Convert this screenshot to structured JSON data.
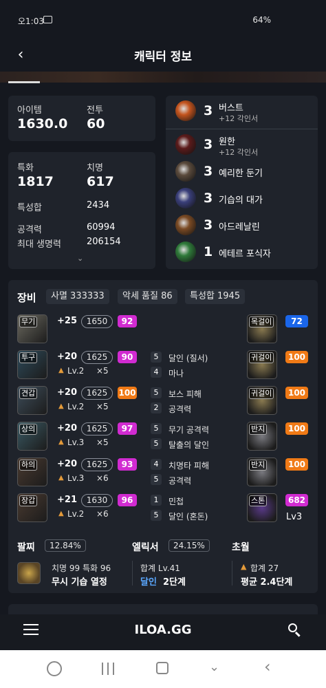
{
  "status": {
    "time": "오1:03",
    "battery": "64%"
  },
  "header": {
    "title": "캐릭터 정보"
  },
  "stats": {
    "item_label": "아이템",
    "item_value": "1630.0",
    "combat_label": "전투",
    "combat_value": "60",
    "spec_label": "특화",
    "spec_value": "1817",
    "crit_label": "치명",
    "crit_value": "617",
    "total_label": "특성합",
    "total_value": "2434",
    "atk_label": "공격력",
    "atk_value": "60994",
    "hp_label": "최대 생명력",
    "hp_value": "206154"
  },
  "engravings": [
    {
      "level": "3",
      "name": "버스트",
      "sub": "+12 각인서",
      "color": "#c4541e",
      "icon": "burst-icon"
    },
    {
      "level": "3",
      "name": "원한",
      "sub": "+12 각인서",
      "color": "#5b1b1b",
      "icon": "grudge-icon"
    },
    {
      "level": "3",
      "name": "예리한 둔기",
      "sub": "",
      "color": "#5a4a3c",
      "icon": "keen-blunt-icon"
    },
    {
      "level": "3",
      "name": "기습의 대가",
      "sub": "",
      "color": "#3a3f7a",
      "icon": "ambush-icon"
    },
    {
      "level": "3",
      "name": "아드레날린",
      "sub": "",
      "color": "#7a4a24",
      "icon": "adrenaline-icon"
    },
    {
      "level": "1",
      "name": "에테르 포식자",
      "sub": "",
      "color": "#2f7a3a",
      "icon": "ether-icon"
    }
  ],
  "equipment": {
    "title": "장비",
    "chips": [
      "사멸 333333",
      "악세 품질 86",
      "특성합 1945"
    ],
    "gear": [
      {
        "tag": "무기",
        "refine": "+25",
        "ilvl": "1650",
        "quality": "92",
        "qcolor": "#d12bd1",
        "elixir": "",
        "count": ""
      },
      {
        "tag": "투구",
        "refine": "+20",
        "ilvl": "1625",
        "quality": "90",
        "qcolor": "#d12bd1",
        "elixir": "Lv.2",
        "count": "×5"
      },
      {
        "tag": "견갑",
        "refine": "+20",
        "ilvl": "1625",
        "quality": "100",
        "qcolor": "#f07a16",
        "elixir": "Lv.2",
        "count": "×5"
      },
      {
        "tag": "상의",
        "refine": "+20",
        "ilvl": "1625",
        "quality": "97",
        "qcolor": "#d12bd1",
        "elixir": "Lv.3",
        "count": "×5"
      },
      {
        "tag": "하의",
        "refine": "+20",
        "ilvl": "1625",
        "quality": "93",
        "qcolor": "#d12bd1",
        "elixir": "Lv.3",
        "count": "×6"
      },
      {
        "tag": "장갑",
        "refine": "+21",
        "ilvl": "1630",
        "quality": "96",
        "qcolor": "#d12bd1",
        "elixir": "Lv.2",
        "count": "×6"
      }
    ],
    "effects": [
      [
        {
          "n": "5",
          "t": "달인 (질서)"
        },
        {
          "n": "4",
          "t": "마나"
        }
      ],
      [
        {
          "n": "5",
          "t": "보스 피해"
        },
        {
          "n": "2",
          "t": "공격력"
        }
      ],
      [
        {
          "n": "5",
          "t": "무기 공격력"
        },
        {
          "n": "5",
          "t": "탈출의 달인"
        }
      ],
      [
        {
          "n": "4",
          "t": "치명타 피해"
        },
        {
          "n": "5",
          "t": "공격력"
        }
      ],
      [
        {
          "n": "1",
          "t": "민첩"
        },
        {
          "n": "5",
          "t": "달인 (혼돈)"
        }
      ]
    ],
    "accessories": [
      {
        "tag": "목걸이",
        "quality": "72",
        "qcolor": "#1a66ea"
      },
      {
        "tag": "귀걸이",
        "quality": "100",
        "qcolor": "#f07a16"
      },
      {
        "tag": "귀걸이",
        "quality": "100",
        "qcolor": "#f07a16"
      },
      {
        "tag": "반지",
        "quality": "100",
        "qcolor": "#f07a16"
      },
      {
        "tag": "반지",
        "quality": "100",
        "qcolor": "#f07a16"
      },
      {
        "tag": "스톤",
        "quality": "682",
        "qcolor": "#d12bd1",
        "extra": "Lv3"
      }
    ],
    "bracelet": {
      "label": "팔찌",
      "chip": "12.84%",
      "line1": "치명 99  특화 96",
      "line2": "무시  기습  열정"
    },
    "elixir": {
      "label": "엘릭서",
      "chip": "24.15%",
      "line1": "합계 Lv.41",
      "line2a": "달인",
      "line2b": "2단계"
    },
    "transcend": {
      "label": "초월",
      "line1": "합계 27",
      "line2": "평균 2.4단계"
    }
  },
  "nav": {
    "logo": "ILOA.GG"
  }
}
